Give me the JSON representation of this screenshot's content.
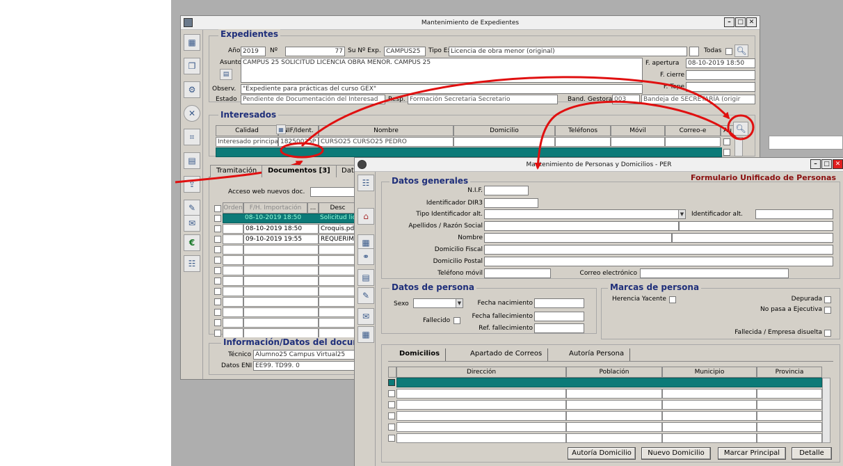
{
  "win1": {
    "title": "Mantenimiento de Expedientes",
    "expedientes": {
      "heading": "Expedientes",
      "anio_label": "Año",
      "anio_value": "2019",
      "n_label": "Nº",
      "n_value": "77",
      "su_label": "Su Nº Exp.",
      "su_value": "CAMPUS25",
      "tipo_label": "Tipo Exp.",
      "tipo_value": "Licencia de obra menor (original)",
      "todas_label": "Todas",
      "asunto_label": "Asunto",
      "asunto_value": "CAMPUS 25 SOLICITUD LICENCIA OBRA MENOR. CAMPUS 25",
      "fapertura_label": "F. apertura",
      "fapertura_value": "08-10-2019 18:50",
      "fcierre_label": "F. cierre",
      "ftope_label": "F. Tope",
      "observ_label": "Observ.",
      "observ_value": "\"Expediente para prácticas del curso GEX\"",
      "estado_label": "Estado",
      "estado_value": "Pendiente de Documentación del Interesad",
      "resp_label": "Resp.",
      "resp_value": "Formación Secretaria Secretario",
      "band_label": "Band. Gestora",
      "band_value": "003",
      "band_desc": "Bandeja de SECRETARÍA (origir"
    },
    "interesados": {
      "heading": "Interesados",
      "columns": [
        "Calidad",
        "NIF/Ident.",
        "Nombre",
        "Domicilio",
        "Teléfonos",
        "Móvil",
        "Correo-e",
        "Au"
      ],
      "row": {
        "calidad": "Interesado principal",
        "nif": "18250025P",
        "nombre": "CURSO25 CURSO25 PEDRO"
      }
    },
    "tabs": [
      "Tramitación",
      "Documentos [3]",
      "Dato"
    ],
    "acceso_label": "Acceso web nuevos doc.",
    "docs": {
      "columns": [
        "Orden",
        "F/H. Importación",
        "...",
        "Desc"
      ],
      "rows": [
        {
          "fecha": "08-10-2019 18:50",
          "desc": "Solicitud licen"
        },
        {
          "fecha": "08-10-2019 18:50",
          "desc": "Croquis.pdf"
        },
        {
          "fecha": "09-10-2019 19:55",
          "desc": "REQUERIMIEN"
        }
      ]
    },
    "info": {
      "heading": "Información/Datos del documen",
      "tecnico_label": "Técnico",
      "tecnico_value": "Alumno25 Campus Virtual25",
      "eni_label": "Datos ENI",
      "eni_value": "EE99. TD99. 0"
    }
  },
  "win2": {
    "title": "Mantenimiento de Personas y Domicilios - PER",
    "subtitle": "Formulario Unificado de Personas",
    "generales": {
      "heading": "Datos generales",
      "nif_label": "N.I.F.",
      "dir3_label": "Identificador DIR3",
      "tipo_alt_label": "Tipo Identificador alt.",
      "id_alt_label": "Identificador alt.",
      "apellidos_label": "Apellidos / Razón Social",
      "nombre_label": "Nombre",
      "dom_fiscal_label": "Domicilio Fiscal",
      "dom_postal_label": "Domicilio Postal",
      "movil_label": "Teléfono móvil",
      "correo_label": "Correo electrónico"
    },
    "persona": {
      "heading": "Datos de persona",
      "sexo_label": "Sexo",
      "fnac_label": "Fecha nacimiento",
      "fallecido_label": "Fallecido",
      "ffall_label": "Fecha fallecimiento",
      "reffall_label": "Ref. fallecimiento"
    },
    "marcas": {
      "heading": "Marcas de persona",
      "herencia_label": "Herencia Yacente",
      "depurada_label": "Depurada",
      "ejecutiva_label": "No pasa a Ejecutiva",
      "fallecida_label": "Fallecida / Empresa disuelta"
    },
    "tabs": [
      "Domicilios",
      "Apartado de Correos",
      "Autoría Persona"
    ],
    "dom_columns": [
      "Dirección",
      "Población",
      "Municipio",
      "Provincia"
    ],
    "buttons": {
      "autoria": "Autoría Domicilio",
      "nuevo": "Nuevo Domicilio",
      "marcar": "Marcar Principal",
      "detalle": "Detalle"
    }
  },
  "colors": {
    "teal": "#0c7a78",
    "annotation": "#e01010",
    "heading": "#1f2f7a",
    "subtitle": "#8a1010"
  }
}
